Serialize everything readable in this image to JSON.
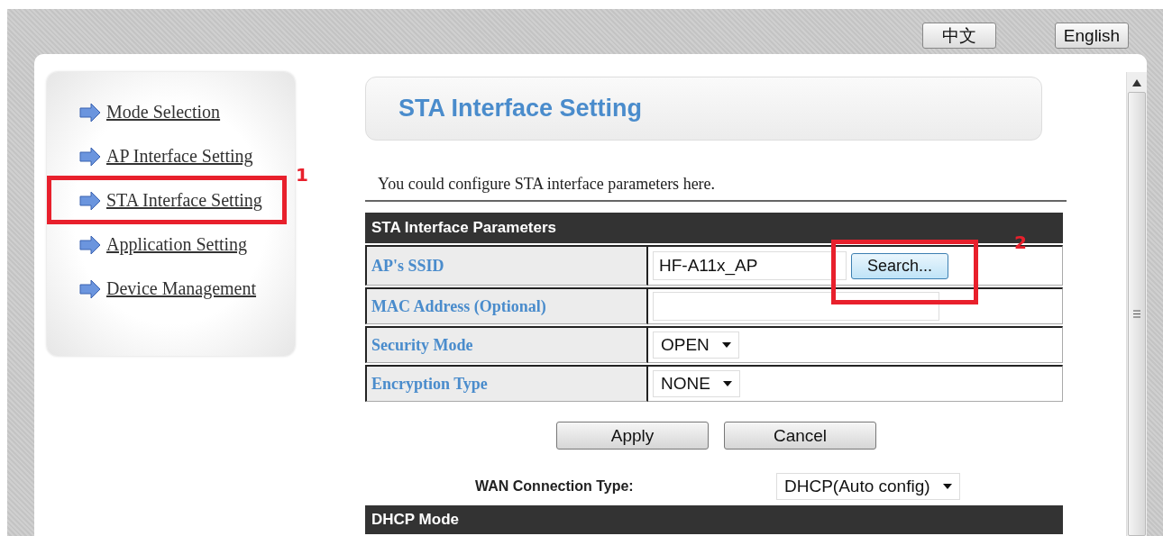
{
  "language_buttons": [
    {
      "label": "中文"
    },
    {
      "label": "English"
    }
  ],
  "sidebar": {
    "items": [
      {
        "label": "Mode Selection",
        "highlighted": false
      },
      {
        "label": "AP Interface Setting",
        "highlighted": false
      },
      {
        "label": "STA Interface Setting",
        "highlighted": true,
        "annotation": "1"
      },
      {
        "label": "Application Setting",
        "highlighted": false
      },
      {
        "label": "Device Management",
        "highlighted": false
      }
    ]
  },
  "page_title": "STA Interface Setting",
  "description": "You could configure STA interface parameters here.",
  "parameters_table": {
    "title": "STA Interface Parameters",
    "rows": [
      {
        "kind": "text",
        "label": "AP's SSID",
        "value": "HF-A11x_AP",
        "button": "Search...",
        "button_highlighted": true,
        "annotation": "2"
      },
      {
        "kind": "text",
        "label": "MAC Address (Optional)",
        "value": ""
      },
      {
        "kind": "select",
        "label": "Security Mode",
        "value": "OPEN"
      },
      {
        "kind": "select",
        "label": "Encryption Type",
        "value": "NONE"
      }
    ]
  },
  "buttons": [
    "Apply",
    "Cancel"
  ],
  "wan": {
    "label": "WAN Connection Type:",
    "value": "DHCP(Auto config)"
  },
  "dhcp_section": {
    "title": "DHCP Mode"
  }
}
